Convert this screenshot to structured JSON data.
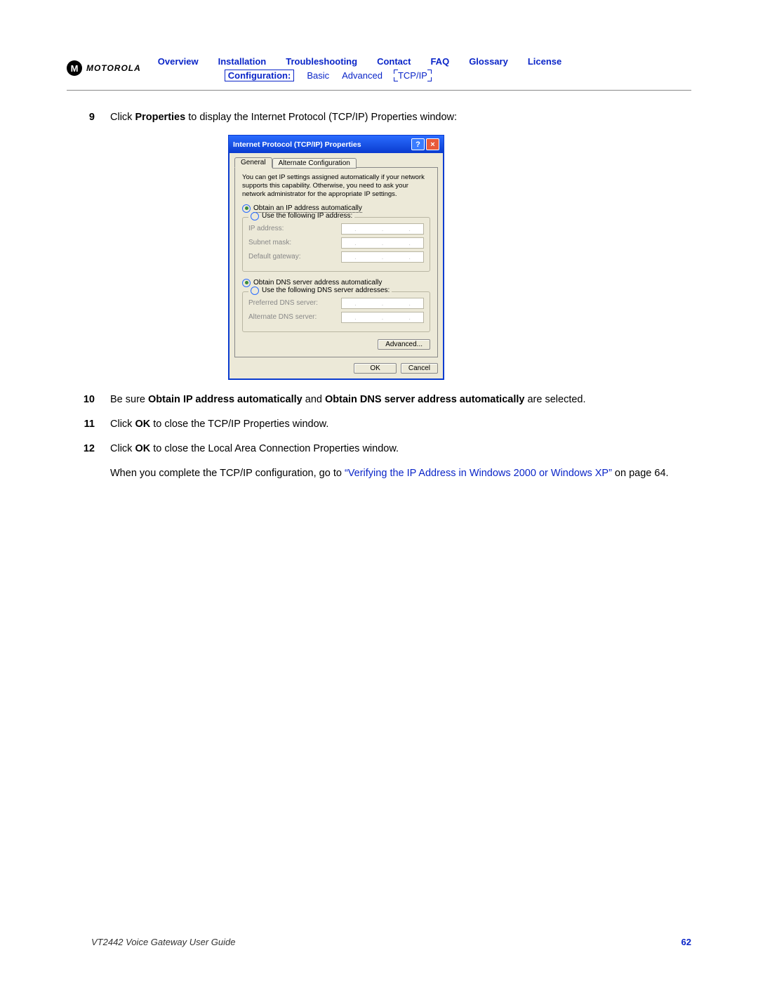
{
  "header": {
    "brand": "MOTOROLA",
    "nav": [
      "Overview",
      "Installation",
      "Troubleshooting",
      "Contact",
      "FAQ",
      "Glossary",
      "License"
    ],
    "config_label": "Configuration:",
    "sub": [
      "Basic",
      "Advanced",
      "TCP/IP"
    ]
  },
  "steps": {
    "s9": {
      "num": "9",
      "pre": "Click ",
      "b1": "Properties",
      "post": " to display the Internet Protocol (TCP/IP) Properties window:"
    },
    "s10": {
      "num": "10",
      "pre": "Be sure ",
      "b1": "Obtain IP address automatically",
      "mid": " and ",
      "b2": "Obtain DNS server address automatically",
      "post": " are selected."
    },
    "s11": {
      "num": "11",
      "pre": "Click ",
      "b1": "OK",
      "post": " to close the TCP/IP Properties window."
    },
    "s12": {
      "num": "12",
      "pre": "Click ",
      "b1": "OK",
      "post": " to close the Local Area Connection Properties window."
    }
  },
  "closing": {
    "pre": "When you complete the TCP/IP configuration, go to ",
    "link": "“Verifying the IP Address in Windows 2000 or Windows XP”",
    "post": " on page 64."
  },
  "dialog": {
    "title": "Internet Protocol (TCP/IP) Properties",
    "tabs": [
      "General",
      "Alternate Configuration"
    ],
    "desc": "You can get IP settings assigned automatically if your network supports this capability. Otherwise, you need to ask your network administrator for the appropriate IP settings.",
    "r1": "Obtain an IP address automatically",
    "r2": "Use the following IP address:",
    "ip_label": "IP address:",
    "subnet_label": "Subnet mask:",
    "gw_label": "Default gateway:",
    "r3": "Obtain DNS server address automatically",
    "r4": "Use the following DNS server addresses:",
    "pref_dns": "Preferred DNS server:",
    "alt_dns": "Alternate DNS server:",
    "advanced": "Advanced...",
    "ok": "OK",
    "cancel": "Cancel"
  },
  "footer": {
    "left": "VT2442 Voice Gateway User Guide",
    "right": "62"
  }
}
